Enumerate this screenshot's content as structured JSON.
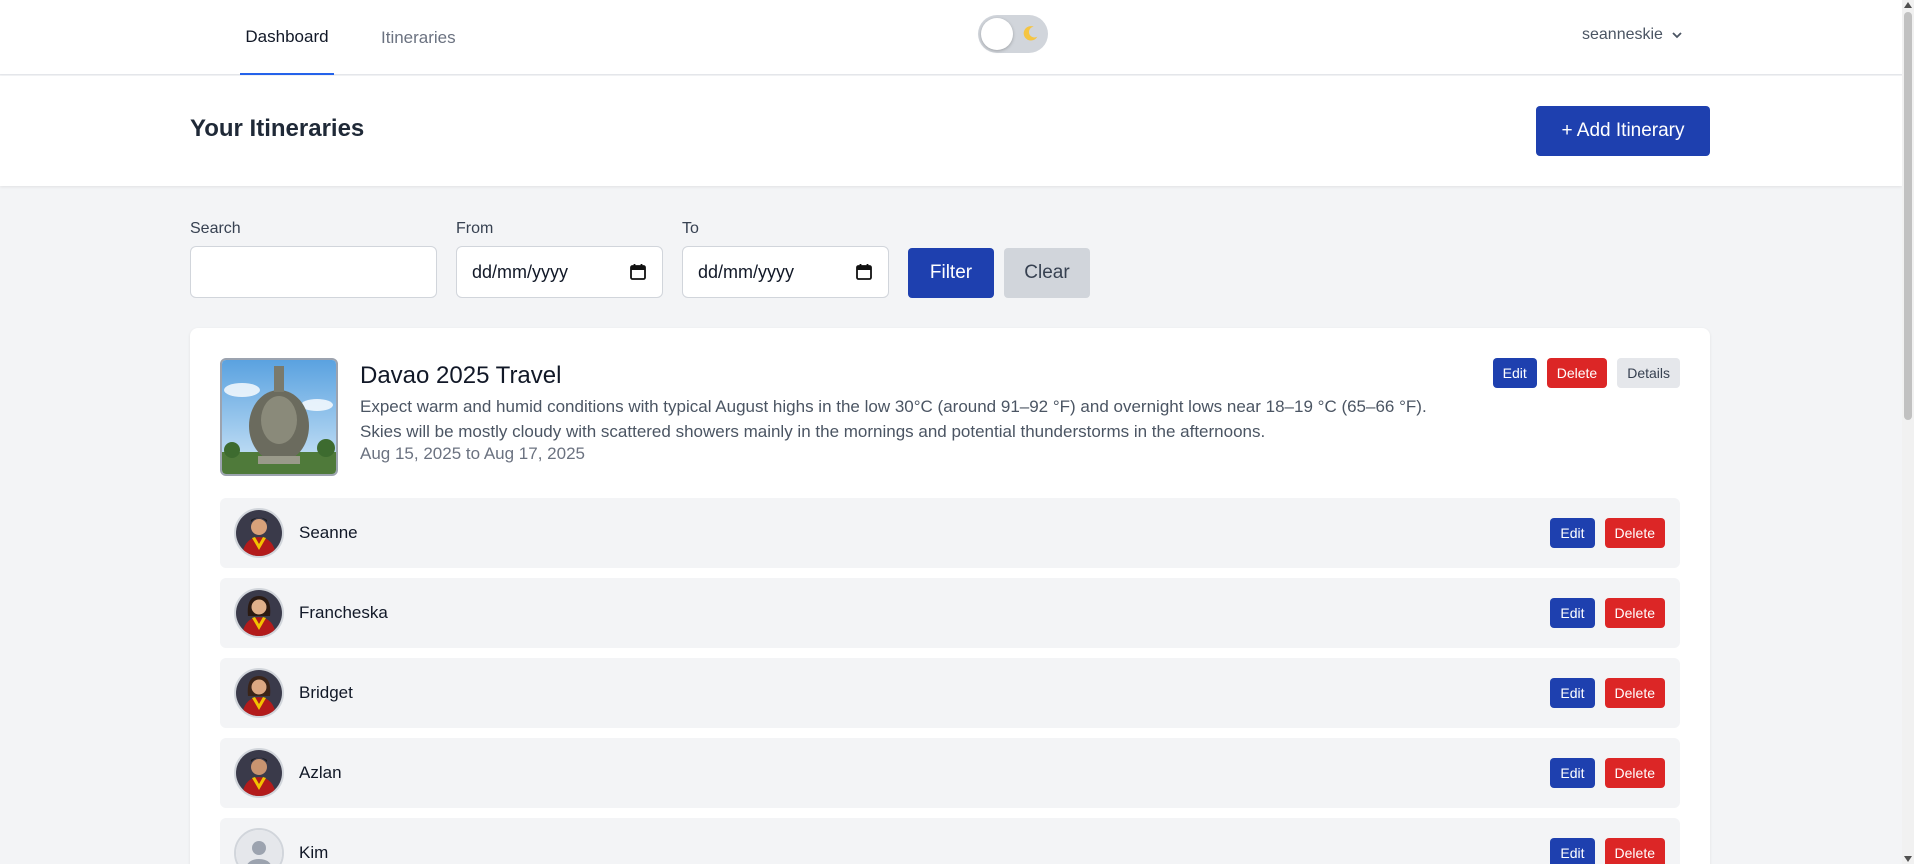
{
  "nav": {
    "tabs": [
      {
        "label": "Dashboard",
        "active": true
      },
      {
        "label": "Itineraries",
        "active": false
      }
    ],
    "theme_toggle": {
      "mode": "light",
      "icon": "moon-icon"
    },
    "user": {
      "name": "seanneskie",
      "icon": "chevron-down-icon"
    }
  },
  "header": {
    "title": "Your Itineraries",
    "add_button_label": "+ Add Itinerary"
  },
  "filters": {
    "search_label": "Search",
    "search_value": "",
    "from_label": "From",
    "from_value": "dd/mm/yyyy",
    "to_label": "To",
    "to_value": "dd/mm/yyyy",
    "filter_button_label": "Filter",
    "clear_button_label": "Clear"
  },
  "itinerary": {
    "title": "Davao 2025 Travel",
    "description": "Expect warm and humid conditions with typical August highs in the low 30°C (around 91–92 °F) and overnight lows near 18–19 °C (65–66 °F). Skies will be mostly cloudy with scattered showers mainly in the mornings and potential thunderstorms in the afternoons.",
    "dates": "Aug 15, 2025 to Aug 17, 2025",
    "edit_label": "Edit",
    "delete_label": "Delete",
    "details_label": "Details",
    "members": [
      {
        "name": "Seanne",
        "avatar": "graduate-male",
        "edit_label": "Edit",
        "delete_label": "Delete"
      },
      {
        "name": "Francheska",
        "avatar": "graduate-female",
        "edit_label": "Edit",
        "delete_label": "Delete"
      },
      {
        "name": "Bridget",
        "avatar": "graduate-female",
        "edit_label": "Edit",
        "delete_label": "Delete"
      },
      {
        "name": "Azlan",
        "avatar": "graduate-male",
        "edit_label": "Edit",
        "delete_label": "Delete"
      },
      {
        "name": "Kim",
        "avatar": "default-user",
        "edit_label": "Edit",
        "delete_label": "Delete"
      }
    ]
  },
  "colors": {
    "primary": "#1e40af",
    "danger": "#dc2626",
    "neutral": "#e5e7eb",
    "background": "#f3f4f6"
  }
}
